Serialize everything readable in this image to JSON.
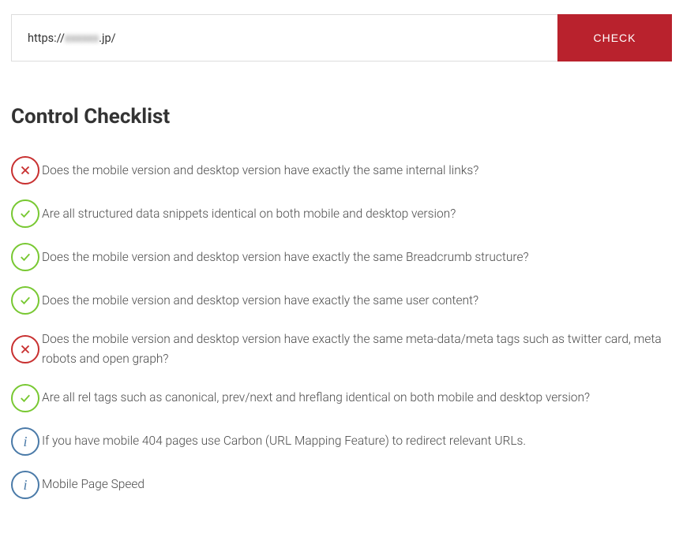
{
  "input": {
    "prefix": "https://",
    "blurred": "xxxxxx",
    "suffix": ".jp/"
  },
  "check_button": "CHECK",
  "heading": "Control Checklist",
  "items": [
    {
      "status": "fail",
      "text": "Does the mobile version and desktop version have exactly the same internal links?"
    },
    {
      "status": "pass",
      "text": "Are all structured data snippets identical on both mobile and desktop version?"
    },
    {
      "status": "pass",
      "text": "Does the mobile version and desktop version have exactly the same Breadcrumb structure?"
    },
    {
      "status": "pass",
      "text": "Does the mobile version and desktop version have exactly the same user content?"
    },
    {
      "status": "fail",
      "text": "Does the mobile version and desktop version have exactly the same meta-data/meta tags such as twitter card, meta robots and open graph?"
    },
    {
      "status": "pass",
      "text": "Are all rel tags such as canonical, prev/next and hreflang identical on both mobile and desktop version?"
    },
    {
      "status": "info",
      "text": "If you have mobile 404 pages use Carbon (URL Mapping Feature) to redirect relevant URLs."
    },
    {
      "status": "info",
      "text": "Mobile Page Speed"
    }
  ]
}
